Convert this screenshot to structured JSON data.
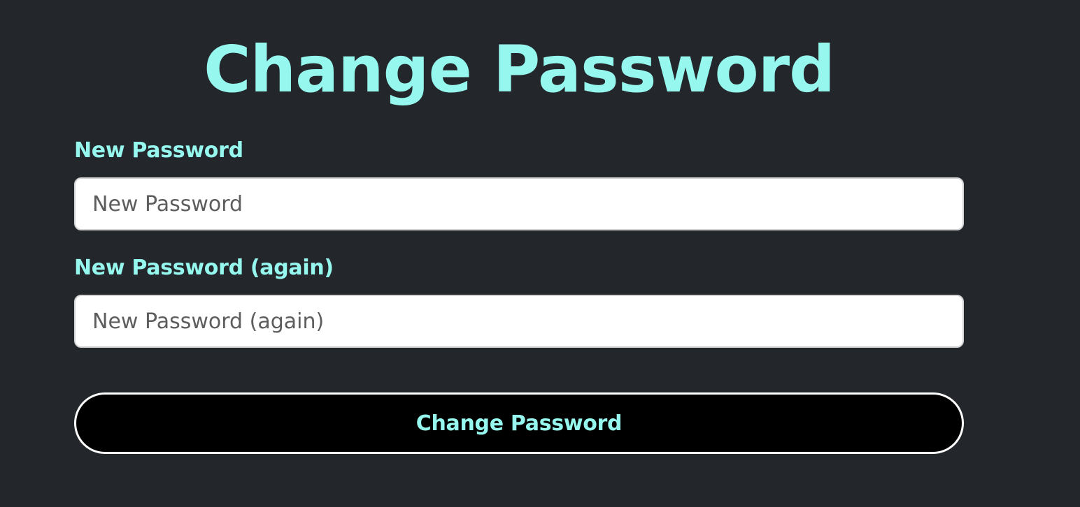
{
  "page": {
    "title": "Change Password"
  },
  "form": {
    "new_password": {
      "label": "New Password",
      "value": "",
      "placeholder": "New Password"
    },
    "new_password_again": {
      "label": "New Password (again)",
      "value": "",
      "placeholder": "New Password (again)"
    },
    "submit_label": "Change Password"
  },
  "colors": {
    "background": "#23272b",
    "accent": "#96f7ef",
    "button_background": "#000000",
    "button_border": "#ffffff",
    "input_background": "#ffffff"
  }
}
